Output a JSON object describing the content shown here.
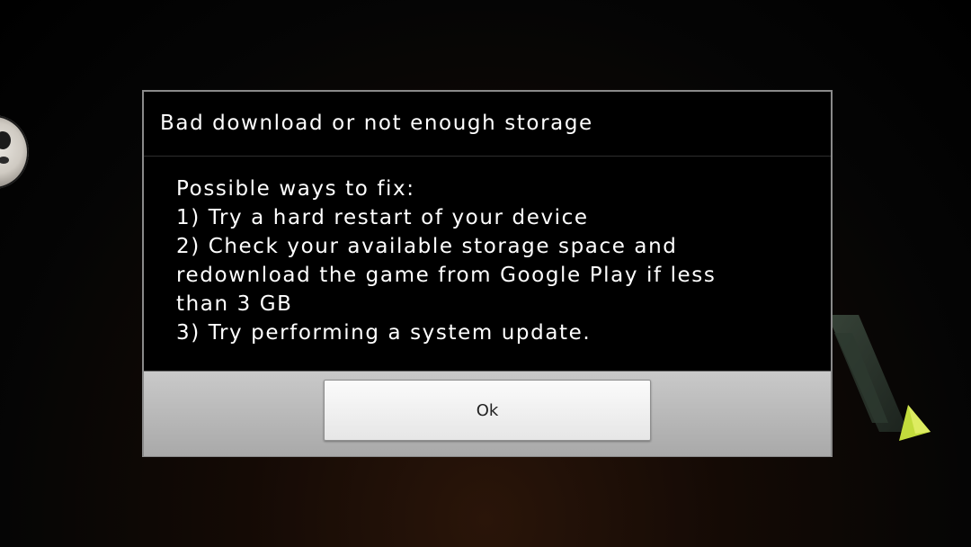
{
  "dialog": {
    "title": "Bad download or not enough storage",
    "message": "Possible ways to fix:\n1) Try a hard restart of your device\n2) Check your available storage space and\nredownload the game from Google Play if less\nthan 3 GB\n3) Try performing a system update.",
    "ok_label": "Ok"
  },
  "colors": {
    "dialog_background": "#000000",
    "button_bar": "#b8b8b8",
    "logo_accent": "#b8d63a"
  }
}
